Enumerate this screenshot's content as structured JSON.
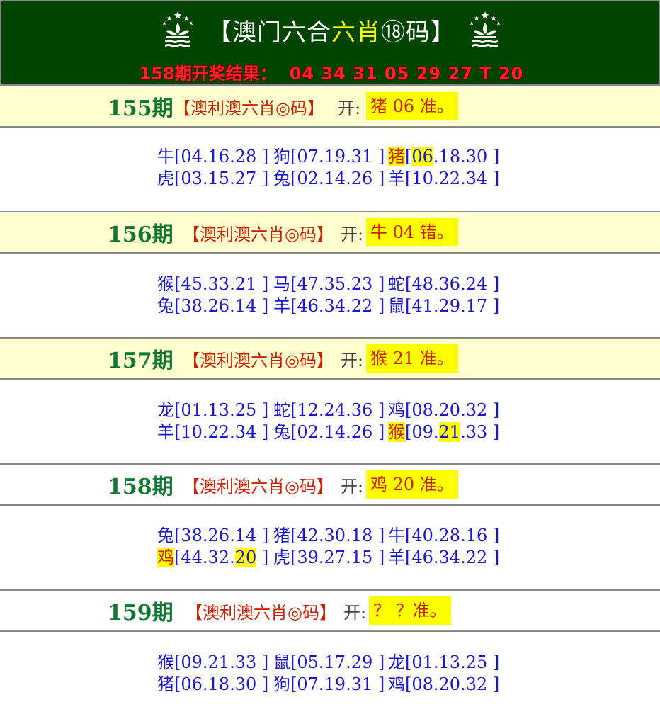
{
  "header": {
    "title_left": "【澳门六合",
    "title_mid": "六肖",
    "title_circle": "⑱",
    "title_right": "码】",
    "result_label": "158期开奖结果：",
    "result_numbers": "04 34 31 05 29 27 T 20"
  },
  "plan_label": "【澳利澳六肖◎码】",
  "kai_label": "开:",
  "sections": [
    {
      "period": "155期",
      "answer": "猪 06 准。",
      "rows": [
        [
          {
            "z": "牛",
            "n": "04.16.28",
            "hl": false,
            "hlpart": ""
          },
          {
            "z": "狗",
            "n": "07.19.31",
            "hl": false,
            "hlpart": ""
          },
          {
            "z": "猪",
            "n": "06.18.30",
            "hl": true,
            "hlpart": "06",
            "rest": ".18.30"
          }
        ],
        [
          {
            "z": "虎",
            "n": "03.15.27",
            "hl": false
          },
          {
            "z": "兔",
            "n": "02.14.26",
            "hl": false
          },
          {
            "z": "羊",
            "n": "10.22.34",
            "hl": false
          }
        ]
      ]
    },
    {
      "period": "156期",
      "answer": "牛 04 错。",
      "rows": [
        [
          {
            "z": "猴",
            "n": "45.33.21",
            "hl": false
          },
          {
            "z": "马",
            "n": "47.35.23",
            "hl": false
          },
          {
            "z": "蛇",
            "n": "48.36.24",
            "hl": false
          }
        ],
        [
          {
            "z": "兔",
            "n": "38.26.14",
            "hl": false
          },
          {
            "z": "羊",
            "n": "46.34.22",
            "hl": false
          },
          {
            "z": "鼠",
            "n": "41.29.17",
            "hl": false
          }
        ]
      ]
    },
    {
      "period": "157期",
      "answer": "猴 21 准。",
      "rows": [
        [
          {
            "z": "龙",
            "n": "01.13.25",
            "hl": false
          },
          {
            "z": "蛇",
            "n": "12.24.36",
            "hl": false
          },
          {
            "z": "鸡",
            "n": "08.20.32",
            "hl": false
          }
        ],
        [
          {
            "z": "羊",
            "n": "10.22.34",
            "hl": false
          },
          {
            "z": "兔",
            "n": "02.14.26",
            "hl": false
          },
          {
            "z": "猴",
            "n": "09.21.33",
            "hl": true,
            "pre": "09.",
            "hlpart": "21",
            "rest": ".33"
          }
        ]
      ]
    },
    {
      "period": "158期",
      "answer": "鸡 20 准。",
      "rows": [
        [
          {
            "z": "兔",
            "n": "38.26.14",
            "hl": false
          },
          {
            "z": "猪",
            "n": "42.30.18",
            "hl": false
          },
          {
            "z": "牛",
            "n": "40.28.16",
            "hl": false
          }
        ],
        [
          {
            "z": "鸡",
            "n": "44.32.20",
            "hl": true,
            "pre": "44.32.",
            "hlpart": "20",
            "rest": ""
          },
          {
            "z": "虎",
            "n": "39.27.15",
            "hl": false
          },
          {
            "z": "羊",
            "n": "46.34.22",
            "hl": false
          }
        ]
      ]
    },
    {
      "period": "159期",
      "answer": "？ ？准。",
      "rows": [
        [
          {
            "z": "猴",
            "n": "09.21.33",
            "hl": false
          },
          {
            "z": "鼠",
            "n": "05.17.29",
            "hl": false
          },
          {
            "z": "龙",
            "n": "01.13.25",
            "hl": false
          }
        ],
        [
          {
            "z": "猪",
            "n": "06.18.30",
            "hl": false
          },
          {
            "z": "狗",
            "n": "07.19.31",
            "hl": false
          },
          {
            "z": "鸡",
            "n": "08.20.32",
            "hl": false
          }
        ]
      ]
    }
  ]
}
